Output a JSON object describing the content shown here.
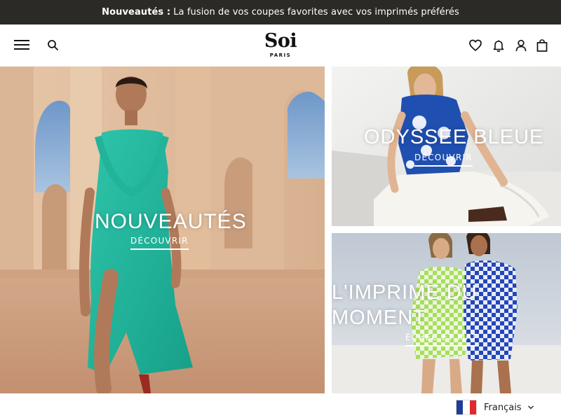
{
  "announcement": {
    "bold": "Nouveautés :",
    "text": "La fusion de vos coupes favorites avec vos imprimés préférés"
  },
  "header": {
    "logo_main": "Soi",
    "logo_sub": "PARIS",
    "icons": [
      "menu-icon",
      "search-icon",
      "heart-icon",
      "bell-icon",
      "user-icon",
      "bag-icon"
    ]
  },
  "tiles": {
    "main": {
      "title": "NOUVEAUTÉS",
      "link": "DÉCOUVRIR"
    },
    "top_right": {
      "title": "ODYSSEE BLEUE",
      "link": "DÉCOUVRIR"
    },
    "bottom_right": {
      "title_line1": "L'IMPRIME DU",
      "title_line2": "MOMENT",
      "link": "ÉCHEC ET MAT"
    }
  },
  "language": {
    "label": "Français",
    "flag_colors": [
      "#1f3d99",
      "#ffffff",
      "#e4262f"
    ]
  }
}
